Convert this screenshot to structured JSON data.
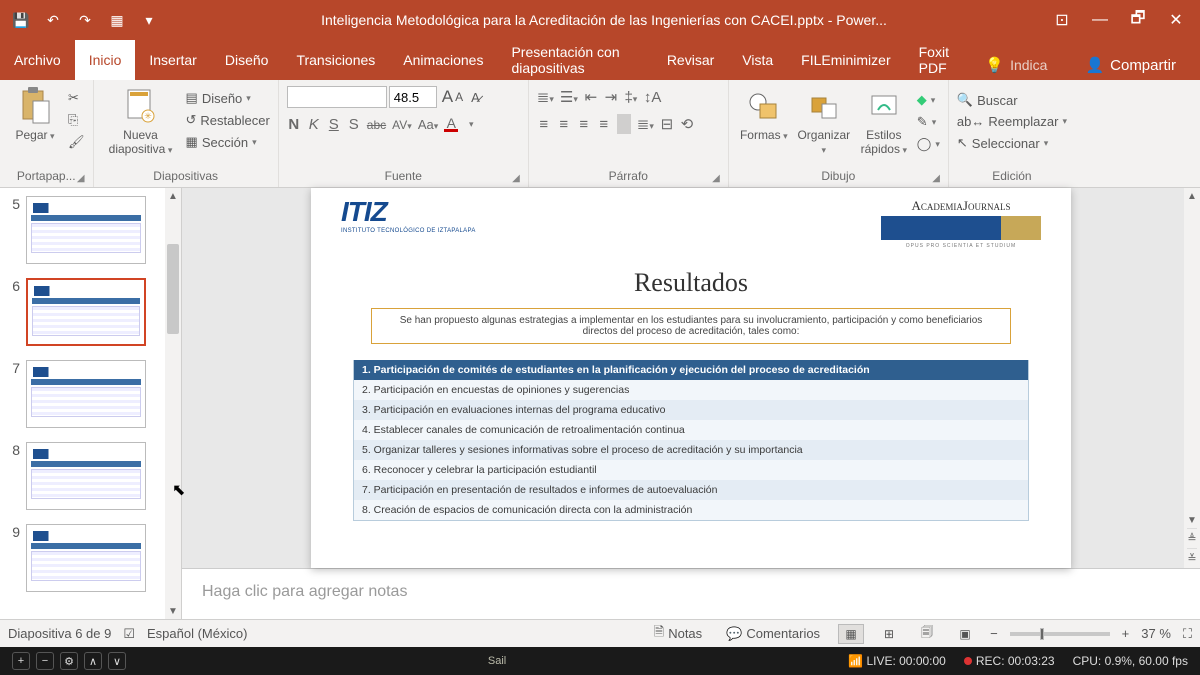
{
  "title": "Inteligencia Metodológica para la Acreditación de las Ingenierías con CACEI.pptx - Power...",
  "qat": {
    "save": "💾",
    "undo": "↶",
    "redo": "↷",
    "start": "▦",
    "more": "▾"
  },
  "win": {
    "touch": "⊡",
    "min": "—",
    "restore": "🗗",
    "close": "✕"
  },
  "tabs": {
    "file": "Archivo",
    "home": "Inicio",
    "insert": "Insertar",
    "design": "Diseño",
    "transitions": "Transiciones",
    "animations": "Animaciones",
    "slideshow": "Presentación con diapositivas",
    "review": "Revisar",
    "view": "Vista",
    "fileminimizer": "FILEminimizer",
    "foxit": "Foxit PDF",
    "tellme": "Indica",
    "share": "Compartir"
  },
  "ribbon": {
    "clipboard": {
      "paste": "Pegar",
      "cut": "✂",
      "copy": "⎘",
      "format_painter": "🖌",
      "group": "Portapap..."
    },
    "slides": {
      "new": "Nueva diapositiva",
      "layout": "Diseño",
      "reset": "Restablecer",
      "section": "Sección",
      "group": "Diapositivas"
    },
    "font": {
      "group": "Fuente",
      "name": "",
      "size": "48.5",
      "grow": "A",
      "shrink": "A",
      "clear": "⌫",
      "bold": "N",
      "italic": "K",
      "underline": "S",
      "shadow": "S",
      "strike": "abc",
      "spacing": "AV",
      "case": "Aa",
      "color": "A"
    },
    "paragraph": {
      "group": "Párrafo"
    },
    "drawing": {
      "group": "Dibujo",
      "shapes": "Formas",
      "arrange": "Organizar",
      "quick": "Estilos rápidos"
    },
    "editing": {
      "group": "Edición",
      "find": "Buscar",
      "replace": "Reemplazar",
      "select": "Seleccionar"
    }
  },
  "thumbs": [
    {
      "n": 5,
      "selected": false
    },
    {
      "n": 6,
      "selected": true
    },
    {
      "n": 7,
      "selected": false
    },
    {
      "n": 8,
      "selected": false
    },
    {
      "n": 9,
      "selected": false
    }
  ],
  "slide": {
    "itiz": "ITIZ",
    "itiz_sub": "INSTITUTO TECNOLÓGICO DE IZTAPALAPA",
    "acad": "AcademiaJournals",
    "acad_motto": "OPUS PRO SCIENTIA ET STUDIUM",
    "title": "Resultados",
    "intro": "Se han propuesto algunas estrategias a implementar en los estudiantes para su  involucramiento, participación y como beneficiarios directos del proceso de acreditación, tales como:",
    "rows": [
      "1. Participación de comités de estudiantes en la planificación y ejecución del proceso de acreditación",
      "2. Participación en encuestas de opiniones y sugerencias",
      "3. Participación en evaluaciones internas del programa educativo",
      "4. Establecer canales de comunicación de retroalimentación continua",
      "5. Organizar talleres y sesiones informativas sobre el proceso de acreditación y su importancia",
      "6. Reconocer y celebrar la participación estudiantil",
      "7. Participación en presentación de resultados e informes de autoevaluación",
      "8. Creación de espacios de comunicación directa con la administración"
    ]
  },
  "notes_placeholder": "Haga clic para agregar notas",
  "status": {
    "slide": "Diapositiva 6 de 9",
    "lang": "Español (México)",
    "notes": "Notas",
    "comments": "Comentarios",
    "zoom": "37 %"
  },
  "obs": {
    "sail": "Sail",
    "live": "LIVE: 00:00:00",
    "rec": "REC: 00:03:23",
    "cpu": "CPU: 0.9%, 60.00 fps"
  }
}
